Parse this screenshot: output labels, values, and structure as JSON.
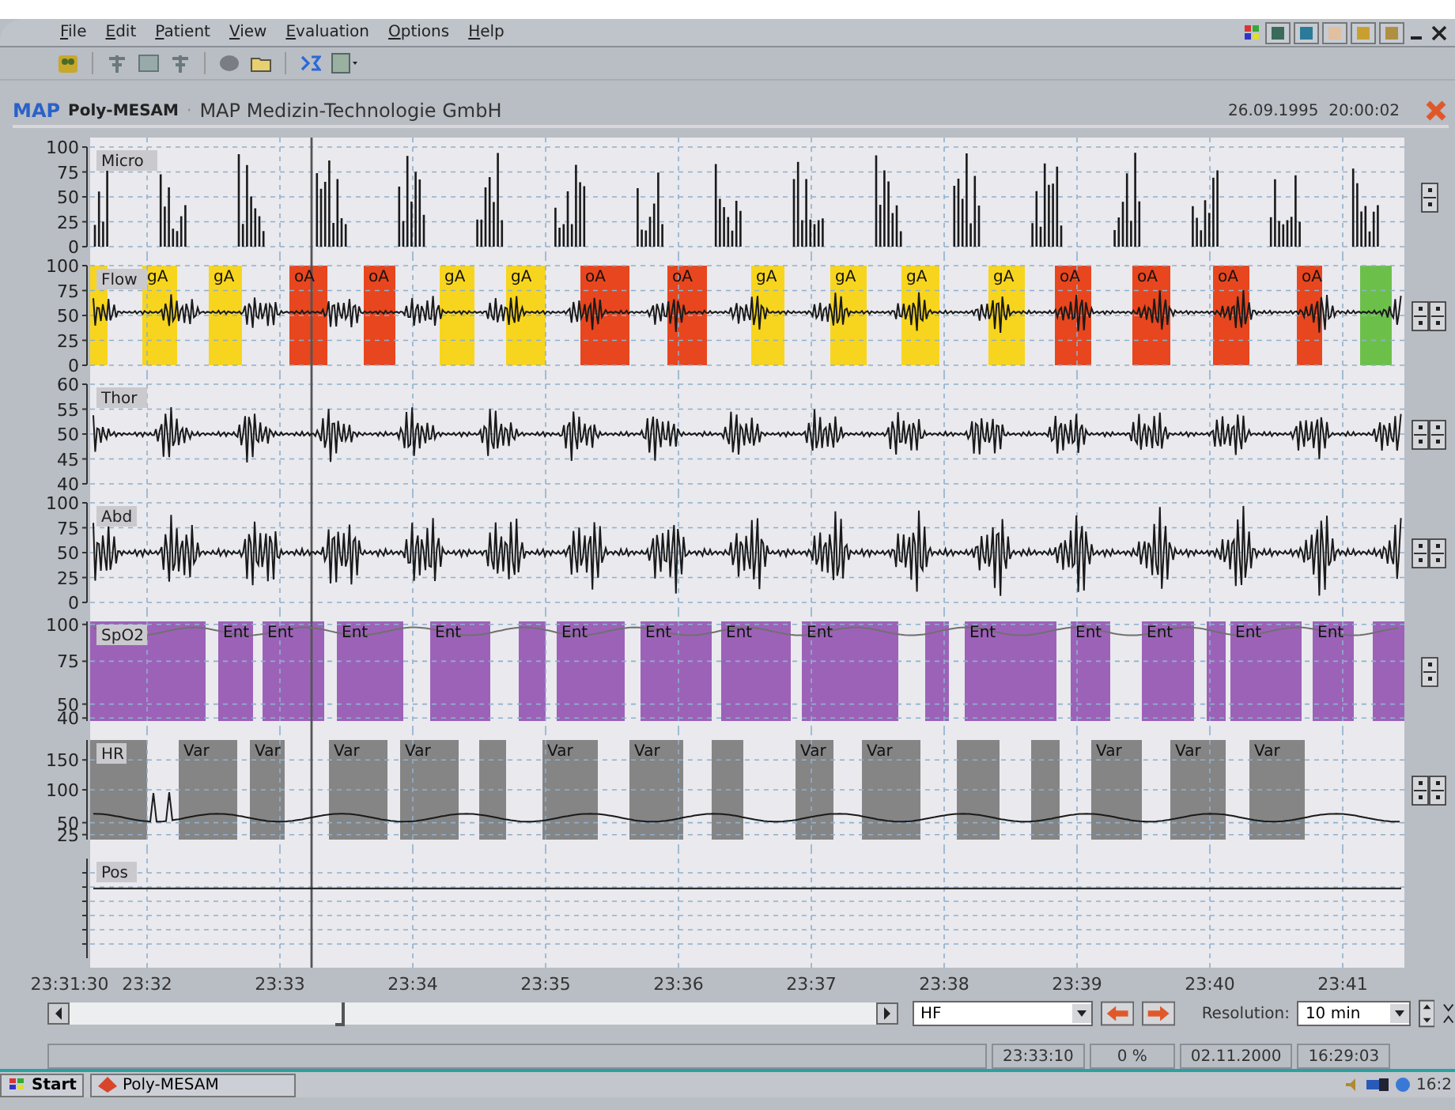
{
  "menu": [
    "File",
    "Edit",
    "Patient",
    "View",
    "Evaluation",
    "Options",
    "Help"
  ],
  "header": {
    "logo": "MAP",
    "product": "Poly-MESAM",
    "separator": "·",
    "company": "MAP Medizin-Technologie GmbH",
    "datetime": "26.09.1995  20:00:02"
  },
  "channels": [
    {
      "name": "Micro",
      "kind": "micro",
      "yticks": [
        "100",
        "75",
        "50",
        "25",
        "0"
      ]
    },
    {
      "name": "Flow",
      "kind": "flow",
      "yticks": [
        "100",
        "75",
        "50",
        "25",
        "0"
      ],
      "events": [
        {
          "color": "#f7d51e"
        },
        {
          "label": "gA",
          "color": "#f7d51e"
        },
        {
          "label": "gA",
          "color": "#f7d51e"
        },
        {
          "label": "oA",
          "color": "#e8461e"
        },
        {
          "label": "oA",
          "color": "#e8461e"
        },
        {
          "label": "gA",
          "color": "#f7d51e"
        },
        {
          "label": "gA",
          "color": "#f7d51e"
        },
        {
          "label": "oA",
          "color": "#e8461e"
        },
        {
          "label": "oA",
          "color": "#e8461e"
        },
        {
          "label": "gA",
          "color": "#f7d51e"
        },
        {
          "label": "gA",
          "color": "#f7d51e"
        },
        {
          "label": "gA",
          "color": "#f7d51e"
        },
        {
          "label": "gA",
          "color": "#f7d51e"
        },
        {
          "label": "oA",
          "color": "#e8461e"
        },
        {
          "label": "oA",
          "color": "#e8461e"
        },
        {
          "label": "oA",
          "color": "#e8461e"
        },
        {
          "label": "oA",
          "color": "#e8461e"
        },
        {
          "color": "#6cc04a"
        }
      ]
    },
    {
      "name": "Thor",
      "kind": "thor",
      "yticks": [
        "60",
        "55",
        "50",
        "45",
        "40"
      ]
    },
    {
      "name": "Abd",
      "kind": "abd",
      "yticks": [
        "100",
        "75",
        "50",
        "25",
        "0"
      ]
    },
    {
      "name": "SpO2",
      "kind": "spo2",
      "yticks": [
        "100",
        "75",
        "50",
        "40"
      ],
      "events": [
        {
          "color": "#9c62b8"
        },
        {
          "label": "Ent",
          "color": "#9c62b8"
        },
        {
          "label": "Ent",
          "color": "#9c62b8"
        },
        {
          "label": "Ent",
          "color": "#9c62b8"
        },
        {
          "label": "Ent",
          "color": "#9c62b8"
        },
        {
          "color": "#9c62b8"
        },
        {
          "label": "Ent",
          "color": "#9c62b8"
        },
        {
          "label": "Ent",
          "color": "#9c62b8"
        },
        {
          "label": "Ent",
          "color": "#9c62b8"
        },
        {
          "label": "Ent",
          "color": "#9c62b8"
        },
        {
          "color": "#9c62b8"
        },
        {
          "label": "Ent",
          "color": "#9c62b8"
        },
        {
          "label": "Ent",
          "color": "#9c62b8"
        },
        {
          "label": "Ent",
          "color": "#9c62b8"
        },
        {
          "color": "#9c62b8"
        },
        {
          "label": "Ent",
          "color": "#9c62b8"
        },
        {
          "label": "Ent",
          "color": "#9c62b8"
        },
        {
          "color": "#9c62b8"
        }
      ]
    },
    {
      "name": "HR",
      "kind": "hr",
      "yticks": [
        "150",
        "100",
        "50",
        "25"
      ],
      "events": [
        {
          "color": "#858585"
        },
        {
          "label": "Var",
          "color": "#858585"
        },
        {
          "label": "Var",
          "color": "#858585"
        },
        {
          "label": "Var",
          "color": "#858585"
        },
        {
          "label": "Var",
          "color": "#858585"
        },
        {
          "color": "#858585"
        },
        {
          "label": "Var",
          "color": "#858585"
        },
        {
          "label": "Var",
          "color": "#858585"
        },
        {
          "color": "#858585"
        },
        {
          "label": "Var",
          "color": "#858585"
        },
        {
          "label": "Var",
          "color": "#858585"
        },
        {
          "color": "#858585"
        },
        {
          "color": "#858585"
        },
        {
          "label": "Var",
          "color": "#858585"
        },
        {
          "label": "Var",
          "color": "#858585"
        },
        {
          "label": "Var",
          "color": "#858585"
        }
      ]
    },
    {
      "name": "Pos",
      "kind": "pos"
    }
  ],
  "time_axis": [
    "23:31:30",
    "23:32",
    "23:33",
    "23:34",
    "23:35",
    "23:36",
    "23:37",
    "23:38",
    "23:39",
    "23:40",
    "23:41"
  ],
  "controls": {
    "channel_select": "HF",
    "resolution_label": "Resolution:",
    "resolution": "10 min"
  },
  "status_bar": [
    "23:33:10",
    "0 %",
    "02.11.2000",
    "16:29:03"
  ],
  "taskbar": {
    "start": "Start",
    "task": "Poly-MESAM",
    "clock": "16:2"
  }
}
